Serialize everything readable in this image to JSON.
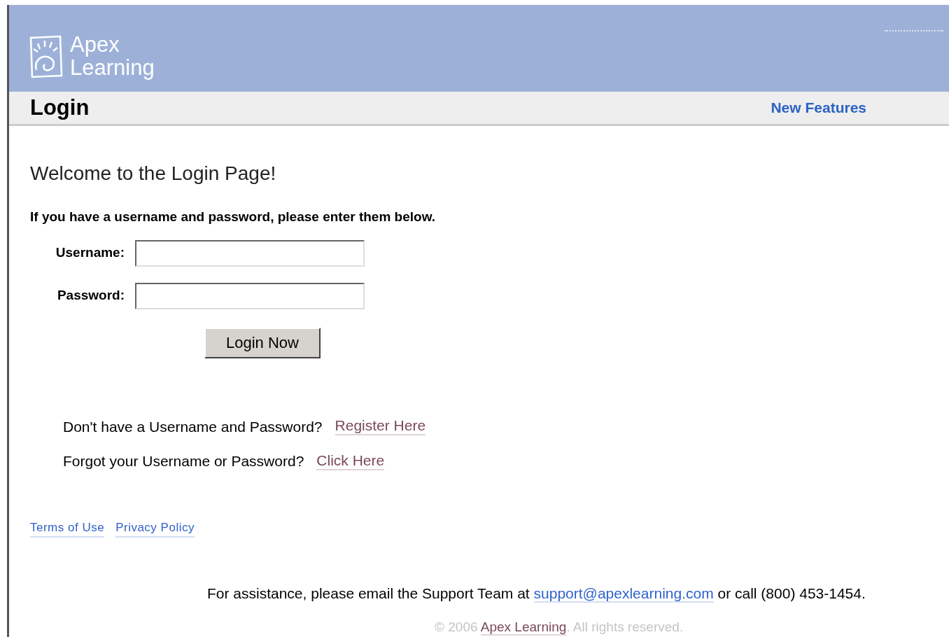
{
  "header": {
    "logo_lines": [
      "Apex",
      "Learning"
    ]
  },
  "title_bar": {
    "title": "Login",
    "link": "New Features"
  },
  "welcome": "Welcome to the Login Page!",
  "instructions": "If you have a username and password, please enter them below.",
  "fields": [
    {
      "label": "Username:"
    },
    {
      "label": "Password:"
    }
  ],
  "login_button": "Login Now",
  "help_rows": [
    {
      "question": "Don't have a Username and Password?",
      "link": "Register Here"
    },
    {
      "question": "Forgot your Username or Password?",
      "link": "Click Here"
    }
  ],
  "footer_links": [
    "Terms of Use",
    "Privacy Policy"
  ],
  "assistance": {
    "before": "For assistance, please email the Support Team at",
    "link": "support@apexlearning.com",
    "after": "or call (800) 453-1454."
  },
  "copyright": {
    "before": "© 2006",
    "link": "Apex Learning",
    "after": ". All rights reserved."
  }
}
